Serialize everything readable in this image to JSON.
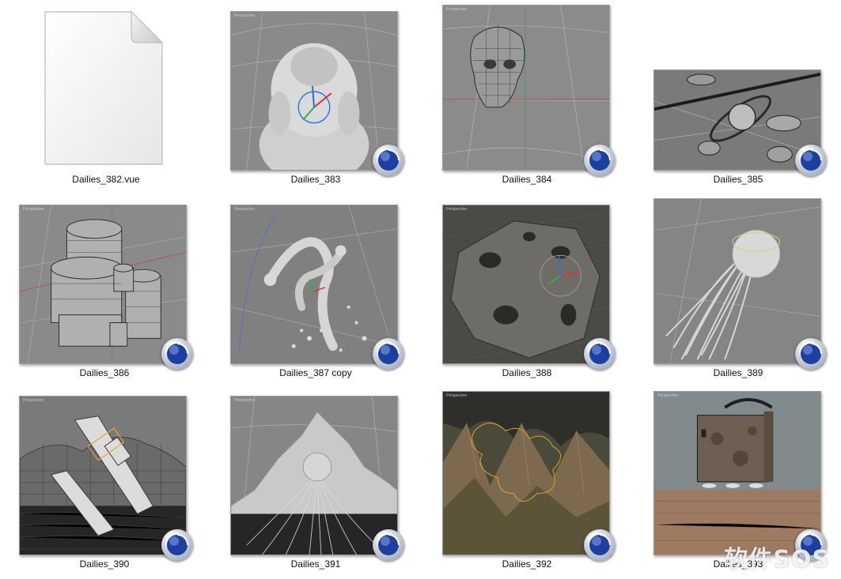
{
  "files": [
    {
      "name": "Dailies_382.vue",
      "kind": "document-icon"
    },
    {
      "name": "Dailies_383",
      "kind": "cinema4d-thumbnail"
    },
    {
      "name": "Dailies_384",
      "kind": "cinema4d-thumbnail"
    },
    {
      "name": "Dailies_385",
      "kind": "cinema4d-thumbnail"
    },
    {
      "name": "Dailies_386",
      "kind": "cinema4d-thumbnail"
    },
    {
      "name": "Dailies_387 copy",
      "kind": "cinema4d-thumbnail"
    },
    {
      "name": "Dailies_388",
      "kind": "cinema4d-thumbnail"
    },
    {
      "name": "Dailies_389",
      "kind": "cinema4d-thumbnail"
    },
    {
      "name": "Dailies_390",
      "kind": "cinema4d-thumbnail"
    },
    {
      "name": "Dailies_391",
      "kind": "cinema4d-thumbnail"
    },
    {
      "name": "Dailies_392",
      "kind": "cinema4d-thumbnail"
    },
    {
      "name": "Dailies_393",
      "kind": "cinema4d-thumbnail"
    }
  ],
  "viewport_label": "Perspective",
  "watermark": "软件SOS",
  "colors": {
    "background": "#ffffff",
    "label_text": "#111111",
    "viewport_gray": "#7f7f7f",
    "badge_blue": "#1d3f9e"
  }
}
